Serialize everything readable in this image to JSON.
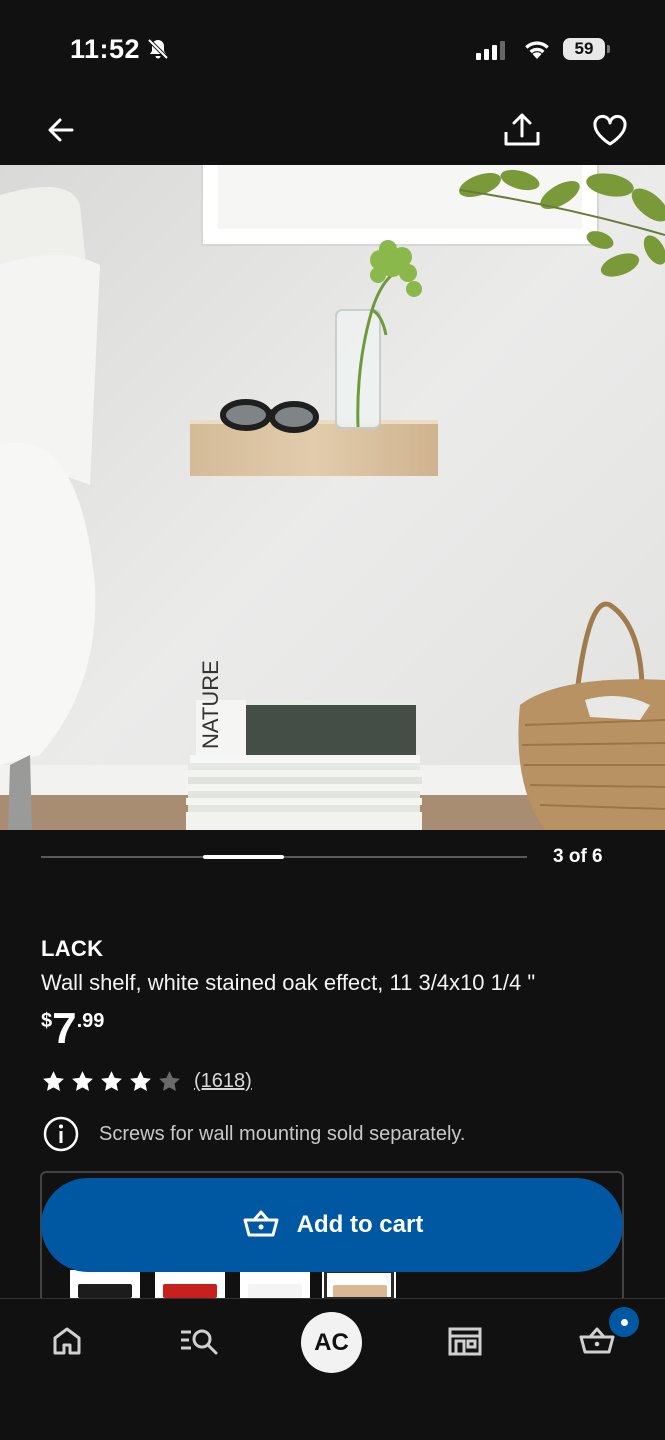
{
  "status_bar": {
    "time": "11:52",
    "battery": "59"
  },
  "nav": {
    "back_icon": "arrow-left-icon",
    "share_icon": "share-icon",
    "favorite_icon": "heart-icon"
  },
  "gallery": {
    "counter": "3 of 6",
    "current_index": 3,
    "total": 6,
    "book_spine_text": "NATURE"
  },
  "product": {
    "name": "LACK",
    "description": "Wall shelf, white stained oak effect, 11 3/4x10 1/4 \"",
    "price_currency": "$",
    "price_integer": "7",
    "price_decimal": ".99",
    "rating_value": 4,
    "rating_max": 5,
    "rating_count": "(1618)",
    "notice": "Screws for wall mounting sold separately."
  },
  "cart_button": {
    "label": "Add to cart",
    "icon": "basket-icon"
  },
  "color_variants": [
    {
      "name": "black",
      "color": "#1c1c1c"
    },
    {
      "name": "red",
      "color": "#c8201e"
    },
    {
      "name": "white",
      "color": "#f4f4f4"
    },
    {
      "name": "white-stained-oak",
      "color": "#d9b893",
      "selected": true
    }
  ],
  "tab_bar": {
    "home_icon": "home-icon",
    "search_icon": "search-list-icon",
    "avatar_initials": "AC",
    "store_icon": "store-icon",
    "cart_icon": "basket-icon"
  },
  "colors": {
    "background": "#111111",
    "accent_blue": "#0058a3",
    "text": "#ffffff"
  }
}
